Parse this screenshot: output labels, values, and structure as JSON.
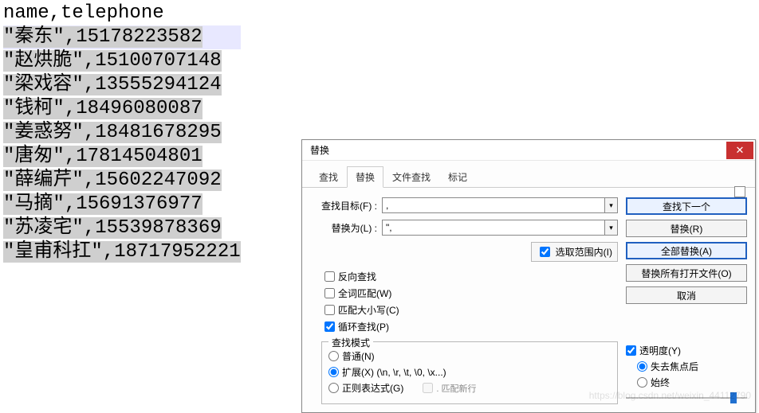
{
  "editor": {
    "header": "name,telephone",
    "rows": [
      {
        "name": "\"秦东\"",
        "phone": ",15178223582",
        "hl": true
      },
      {
        "name": "\"赵烘脆\"",
        "phone": ",15100707148"
      },
      {
        "name": "\"梁戏容\"",
        "phone": ",13555294124"
      },
      {
        "name": "\"钱柯\"",
        "phone": ",18496080087"
      },
      {
        "name": "\"姜惑努\"",
        "phone": ",18481678295"
      },
      {
        "name": "\"唐匆\"",
        "phone": ",17814504801"
      },
      {
        "name": "\"薛编芹\"",
        "phone": ",15602247092"
      },
      {
        "name": "\"马摘\"",
        "phone": ",15691376977"
      },
      {
        "name": "\"苏凌宅\"",
        "phone": ",15539878369"
      },
      {
        "name": "\"皇甫科扛\"",
        "phone": ",18717952221"
      }
    ]
  },
  "dialog": {
    "title": "替换",
    "close_glyph": "✕",
    "tabs": {
      "find": "查找",
      "replace": "替换",
      "findinfiles": "文件查找",
      "mark": "标记"
    },
    "find_label": "查找目标(F) :",
    "find_value": ",",
    "replace_label": "替换为(L) :",
    "replace_value": "\",",
    "combo_glyph": "▾",
    "in_selection_label": "选取范围内(I)",
    "in_selection_checked": true,
    "options": {
      "backward": {
        "label": "反向查找",
        "checked": false
      },
      "wholeword": {
        "label": "全词匹配(W)",
        "checked": false
      },
      "matchcase": {
        "label": "匹配大小写(C)",
        "checked": false
      },
      "wrap": {
        "label": "循环查找(P)",
        "checked": true
      }
    },
    "mode": {
      "legend": "查找模式",
      "normal": "普通(N)",
      "extended": "扩展(X) (\\n, \\r, \\t, \\0, \\x...)",
      "regex": "正则表达式(G)",
      "match_newline": ". 匹配新行",
      "selected": "extended"
    },
    "buttons": {
      "findnext": "查找下一个",
      "replace": "替换(R)",
      "replaceall": "全部替换(A)",
      "replaceinopen": "替换所有打开文件(O)",
      "cancel": "取消"
    },
    "transparency": {
      "label": "透明度(Y)",
      "checked": true,
      "onlosefocus": "失去焦点后",
      "always": "始终",
      "selected": "onlosefocus"
    }
  },
  "watermark": "https://blog.csdn.net/weixin_44112790"
}
